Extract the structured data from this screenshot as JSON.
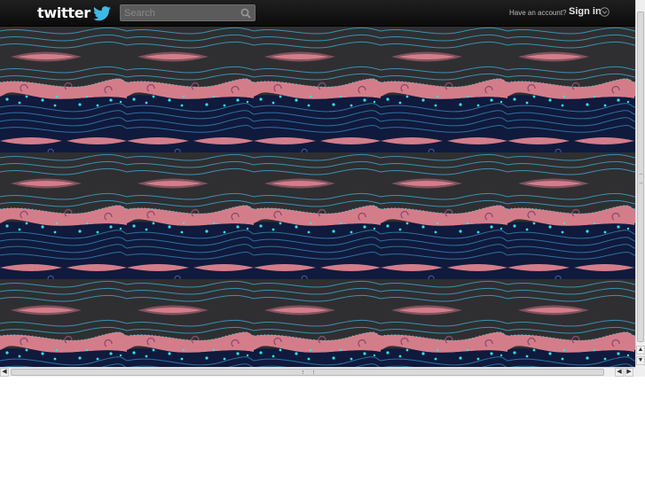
{
  "header": {
    "logo_text": "twitter",
    "logo_icon": "bird-icon"
  },
  "search": {
    "placeholder": "Search",
    "value": "",
    "icon": "search-icon"
  },
  "account": {
    "prompt": "Have an account?",
    "sign_in_label": "Sign in",
    "dropdown_icon": "chevron-down-icon"
  },
  "background": {
    "colors": {
      "charcoal": "#2f2f31",
      "navy": "#0f1a3d",
      "pink": "#d47d8a",
      "teal_line": "#3c8fae",
      "cyan_dot": "#31e2e8"
    }
  },
  "scrollbars": {
    "up_arrow": "▲",
    "down_arrow": "▼",
    "left_arrow": "◀",
    "right_arrow": "▶"
  }
}
